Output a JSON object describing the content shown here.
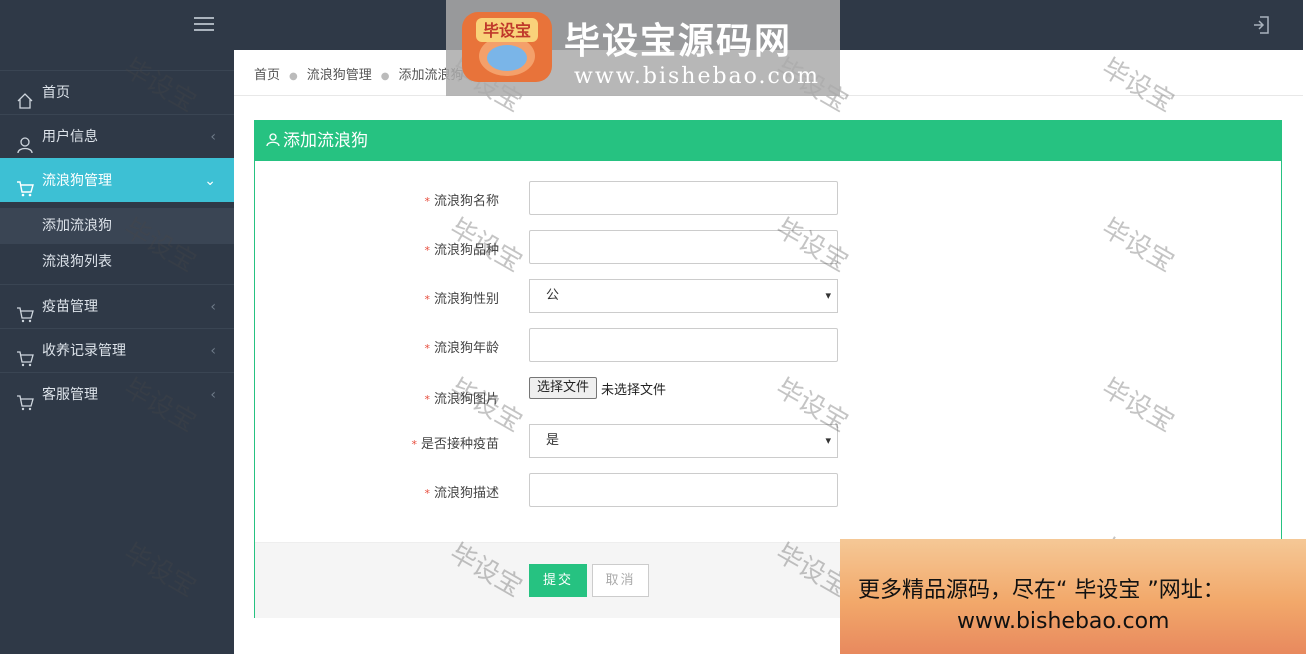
{
  "sidebar": {
    "items": [
      {
        "label": "首页"
      },
      {
        "label": "用户信息"
      },
      {
        "label": "流浪狗管理"
      },
      {
        "label": "疫苗管理"
      },
      {
        "label": "收养记录管理"
      },
      {
        "label": "客服管理"
      }
    ],
    "sub_items": [
      {
        "label": "添加流浪狗"
      },
      {
        "label": "流浪狗列表"
      }
    ]
  },
  "breadcrumb": [
    "首页",
    "流浪狗管理",
    "添加流浪狗"
  ],
  "panel": {
    "title": "添加流浪狗"
  },
  "form": {
    "name_label": "流浪狗名称",
    "breed_label": "流浪狗品种",
    "gender_label": "流浪狗性别",
    "gender_value": "公",
    "age_label": "流浪狗年龄",
    "image_label": "流浪狗图片",
    "file_button": "选择文件",
    "file_status": "未选择文件",
    "vaccinated_label": "是否接种疫苗",
    "vaccinated_value": "是",
    "desc_label": "流浪狗描述",
    "submit": "提交",
    "cancel": "取消"
  },
  "watermark": {
    "banner_logo": "毕设宝",
    "banner_title": "毕设宝源码网",
    "banner_url": "www.bishebao.com",
    "tile": "毕设宝",
    "ad_line1": "更多精品源码，尽在“ 毕设宝 ”网址：",
    "ad_line2": "www.bishebao.com"
  },
  "colors": {
    "accent": "#26c281",
    "active_nav": "#3dc0d4",
    "sidebar_bg": "#2f3947"
  }
}
